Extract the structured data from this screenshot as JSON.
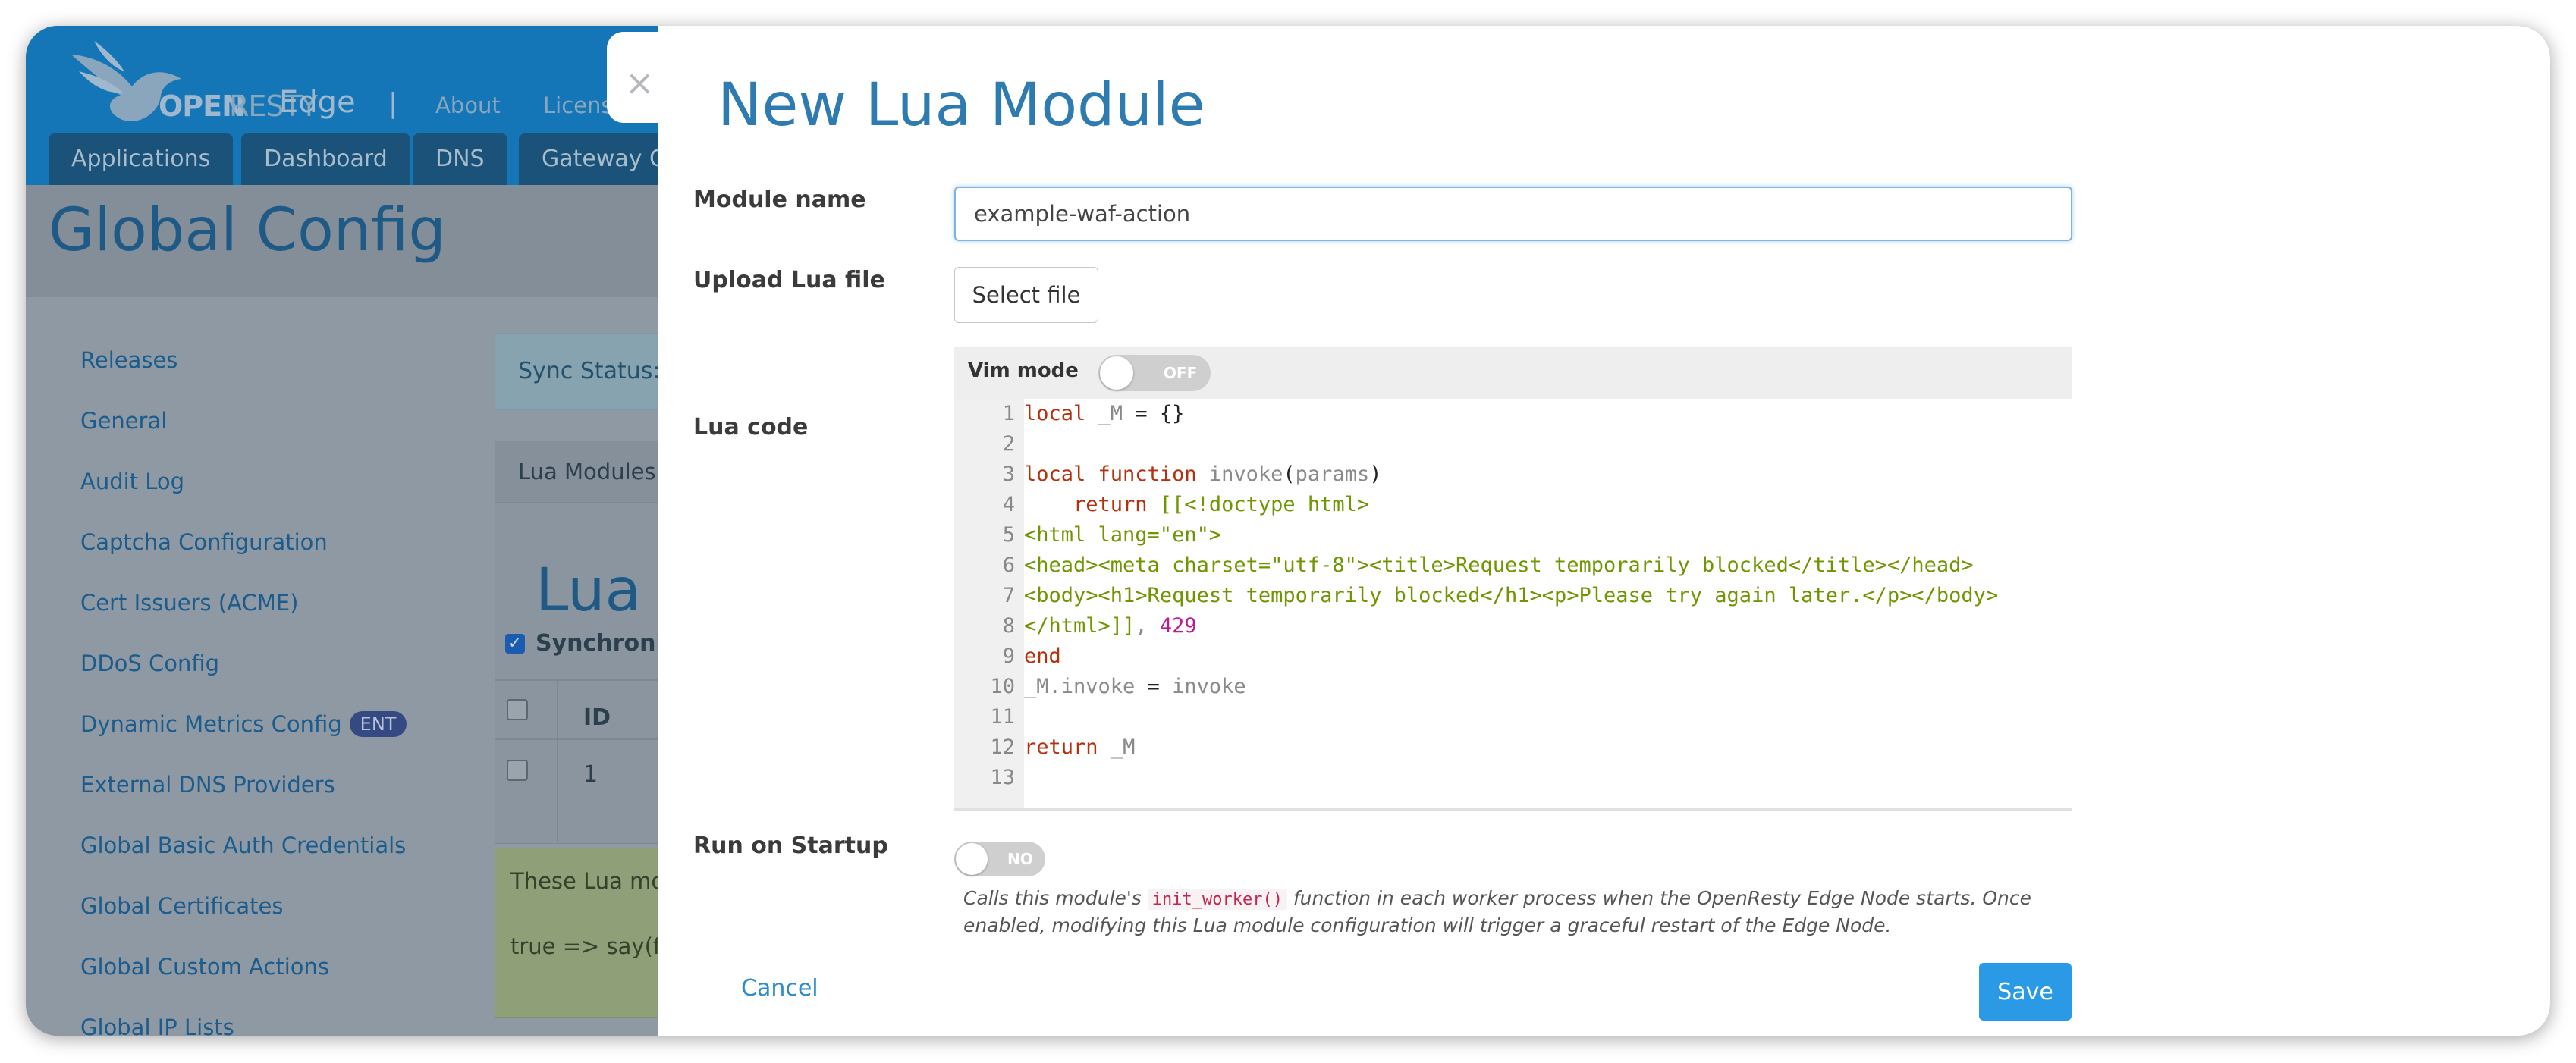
{
  "app": {
    "brand_open": "OPEN",
    "brand_resty": "RESTY",
    "brand_edge": "Edge",
    "nav_separator": "|",
    "nav_links": [
      "About",
      "Licens"
    ],
    "tabs": [
      "Applications",
      "Dashboard",
      "DNS",
      "Gateway Cl"
    ],
    "page_title": "Global Config",
    "sidebar": [
      "Releases",
      "General",
      "Audit Log",
      "Captcha Configuration",
      "Cert Issuers (ACME)",
      "DDoS Config",
      "Dynamic Metrics Config",
      "External DNS Providers",
      "Global Basic Auth Credentials",
      "Global Certificates",
      "Global Custom Actions",
      "Global IP Lists"
    ],
    "ent_badge": "ENT",
    "sync_status": "Sync Status:",
    "panel_tab": "Lua Modules",
    "panel_heading": "Lua",
    "sync_checkbox_label": "Synchroni",
    "table_header_id": "ID",
    "table_row_id": "1",
    "green_box_line1": "These Lua mo",
    "green_box_line2": "true => say(fo"
  },
  "modal": {
    "close_symbol": "×",
    "title": "New Lua Module",
    "module_name_label": "Module name",
    "module_name_value": "example-waf-action",
    "upload_label": "Upload Lua file",
    "select_file_button": "Select file",
    "lua_code_label": "Lua code",
    "vim_mode_label": "Vim mode",
    "vim_toggle_state": "OFF",
    "code_lines": [
      "local _M = {}",
      "",
      "local function invoke(params)",
      "    return [[<!doctype html>",
      "<html lang=\"en\">",
      "<head><meta charset=\"utf-8\"><title>Request temporarily blocked</title></head>",
      "<body><h1>Request temporarily blocked</h1><p>Please try again later.</p></body>",
      "</html>]], 429",
      "end",
      "_M.invoke = invoke",
      "",
      "return _M",
      ""
    ],
    "line_numbers": [
      "1",
      "2",
      "3",
      "4",
      "5",
      "6",
      "7",
      "8",
      "9",
      "10",
      "11",
      "12",
      "13"
    ],
    "run_on_startup_label": "Run on Startup",
    "startup_toggle_state": "NO",
    "help_prefix": "Calls this module's ",
    "help_code": "init_worker()",
    "help_suffix": " function in each worker process when the OpenResty Edge Node starts. Once enabled, modifying this Lua module configuration will trigger a graceful restart of the Edge Node.",
    "cancel_label": "Cancel",
    "save_label": "Save"
  },
  "colors": {
    "navbar": "#1476b6",
    "modal_title": "#2d7bb0",
    "save_button": "#2b9ae6",
    "lua_keyword": "#b5310e",
    "lua_string": "#6f9600",
    "lua_number": "#c2188f"
  },
  "icons": {
    "logo": "openresty-bird-icon",
    "close": "close-icon"
  }
}
